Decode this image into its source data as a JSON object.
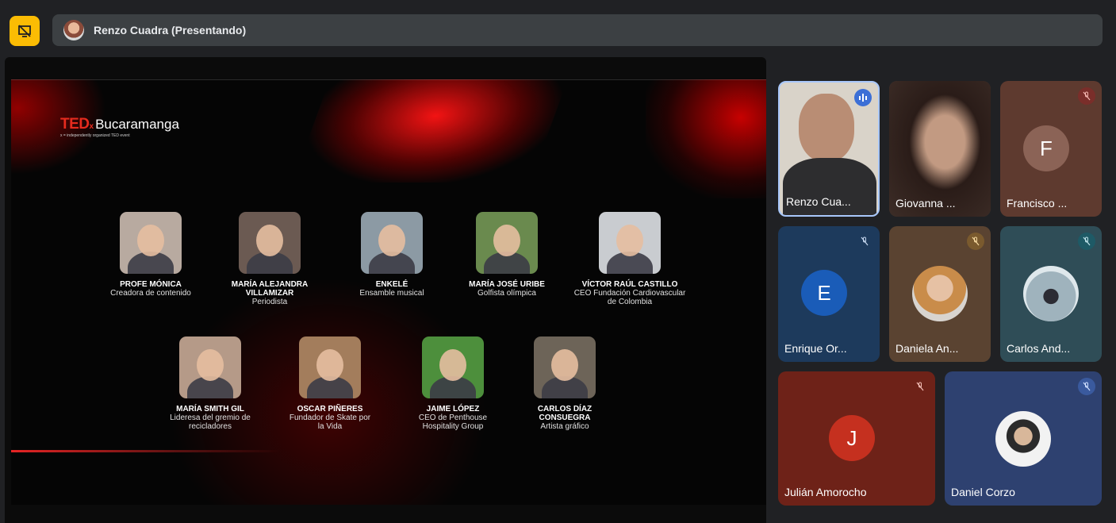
{
  "topbar": {
    "toggle_icon": "presentation-off-icon",
    "presenter_text": "Renzo Cuadra (Presentando)",
    "accent": "#fbbc04"
  },
  "slide": {
    "brand_ted": "TED",
    "brand_x": "x",
    "brand_city": "Bucaramanga",
    "brand_sub": "x = independently organized TED event",
    "speakers_row1": [
      {
        "name": "PROFE MÓNICA",
        "role": "Creadora de contenido"
      },
      {
        "name": "MARÍA ALEJANDRA VILLAMIZAR",
        "role": "Periodista"
      },
      {
        "name": "ENKELÉ",
        "role": "Ensamble musical"
      },
      {
        "name": "MARÍA JOSÉ URIBE",
        "role": "Golfista olímpica"
      },
      {
        "name": "VÍCTOR RAÚL CASTILLO",
        "role": "CEO Fundación Cardiovascular de Colombia"
      }
    ],
    "speakers_row2": [
      {
        "name": "MARÍA SMITH GIL",
        "role": "Lideresa del gremio de recicladores"
      },
      {
        "name": "OSCAR PIÑERES",
        "role": "Fundador de Skate por la Vida"
      },
      {
        "name": "JAIME LÓPEZ",
        "role": "CEO de Penthouse Hospitality Group"
      },
      {
        "name": "CARLOS DÍAZ CONSUEGRA",
        "role": "Artista gráfico"
      }
    ]
  },
  "participants": [
    {
      "name": "Renzo Cua...",
      "type": "video",
      "speaking": true
    },
    {
      "name": "Giovanna ...",
      "type": "video"
    },
    {
      "name": "Francisco ...",
      "letter": "F",
      "muted": true
    },
    {
      "name": "Enrique Or...",
      "letter": "E",
      "muted": true
    },
    {
      "name": "Daniela An...",
      "type": "avatar",
      "muted": true
    },
    {
      "name": "Carlos And...",
      "type": "avatar",
      "muted": true
    },
    {
      "name": "Julián Amorocho",
      "letter": "J",
      "muted": true
    },
    {
      "name": "Daniel Corzo",
      "type": "avatar",
      "muted": true
    }
  ]
}
